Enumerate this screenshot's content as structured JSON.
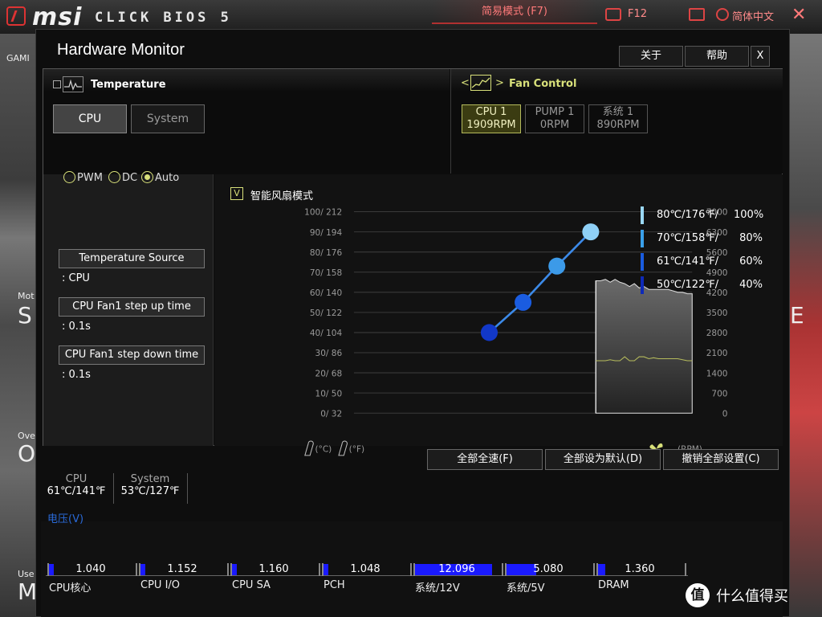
{
  "bios": {
    "brand": "msi",
    "product": "CLICK BIOS 5",
    "ez_mode": "简易模式 (F7)",
    "screenshot_key": "F12",
    "language": "简体中文",
    "left_labels": [
      "GAMI",
      "Mot",
      "S",
      "Ove",
      "O",
      "Use",
      "M"
    ],
    "right_letters": [
      "E"
    ],
    "icons": [
      "msi-logo-icon",
      "screenshot-icon",
      "search-icon",
      "globe-icon",
      "close-icon"
    ]
  },
  "dialog": {
    "title": "Hardware Monitor",
    "buttons": {
      "about": "关于",
      "help": "帮助",
      "close": "X"
    }
  },
  "temperature": {
    "title": "Temperature",
    "tabs": [
      {
        "label": "CPU",
        "active": true
      },
      {
        "label": "System",
        "active": false
      }
    ]
  },
  "fan_control": {
    "title": "Fan Control",
    "prev": "<",
    "next": ">",
    "fans": [
      {
        "name": "CPU 1",
        "rpm": "1909RPM",
        "active": true
      },
      {
        "name": "PUMP 1",
        "rpm": "0RPM",
        "active": false
      },
      {
        "name": "系统 1",
        "rpm": "890RPM",
        "active": false
      }
    ]
  },
  "fan_mode": {
    "options": [
      "PWM",
      "DC",
      "Auto"
    ],
    "selected": "Auto",
    "temperature_source_label": "Temperature Source",
    "temperature_source_value": ": CPU",
    "step_up_label": "CPU Fan1 step up time",
    "step_up_value": ": 0.1s",
    "step_down_label": "CPU Fan1 step down time",
    "step_down_value": ": 0.1s"
  },
  "smart_fan": {
    "checkbox": "V",
    "label": "智能风扇模式",
    "checked": true
  },
  "chart_data": {
    "type": "line",
    "title": "",
    "left_axis_ticks": [
      "100/ 212",
      "90/ 194",
      "80/ 176",
      "70/ 158",
      "60/ 140",
      "50/ 122",
      "40/ 104",
      "30/  86",
      "20/  68",
      "10/  50",
      "0/  32"
    ],
    "left_axis_units": [
      "(°C)",
      "(°F)"
    ],
    "right_axis_ticks": [
      "7000",
      "6300",
      "5600",
      "4900",
      "4200",
      "3500",
      "2800",
      "2100",
      "1400",
      "700",
      "0"
    ],
    "right_axis_unit": "(RPM)",
    "xlim": [
      0,
      100
    ],
    "ylim": [
      0,
      100
    ],
    "curve_points": [
      {
        "temp": 40,
        "speed": 40,
        "color": "#1238c8"
      },
      {
        "temp": 50,
        "speed": 55,
        "color": "#1a5ce0"
      },
      {
        "temp": 60,
        "speed": 73,
        "color": "#3c9ae8"
      },
      {
        "temp": 70,
        "speed": 90,
        "color": "#8fd0f6"
      }
    ],
    "rpm_history_end_x": 100,
    "rpm_history_start_x": 71.5,
    "rpm_trace": [
      4600,
      4600,
      4650,
      4550,
      4650,
      4550,
      4500,
      4400,
      4500,
      4350,
      4400,
      4300,
      4300,
      4300,
      4300,
      4300,
      4250,
      4200,
      4200,
      4150,
      4150
    ],
    "temp_trace": [
      26,
      26,
      26,
      26.5,
      26,
      26,
      28,
      26,
      26,
      28,
      28,
      27,
      27.5,
      27,
      27,
      27,
      27,
      27,
      26.5,
      26,
      26
    ]
  },
  "legend": [
    {
      "text": "80℃/176℉/",
      "pct": "100%",
      "color": "#9ad8f6"
    },
    {
      "text": "70℃/158℉/",
      "pct": "80%",
      "color": "#3aa0ea"
    },
    {
      "text": "61℃/141℉/",
      "pct": "60%",
      "color": "#1a5ce0"
    },
    {
      "text": "50℃/122℉/",
      "pct": "40%",
      "color": "#0e2ab8"
    }
  ],
  "actions": {
    "full_speed": "全部全速(F)",
    "set_default": "全部设为默认(D)",
    "cancel_all": "撤销全部设置(C)"
  },
  "temps": [
    {
      "label": "CPU",
      "value": "61℃/141℉"
    },
    {
      "label": "System",
      "value": "53℃/127℉"
    }
  ],
  "voltage": {
    "title": "电压(V)",
    "items": [
      {
        "label": "CPU核心",
        "value": "1.040",
        "fill": 0.06
      },
      {
        "label": "CPU I/O",
        "value": "1.152",
        "fill": 0.06
      },
      {
        "label": "CPU SA",
        "value": "1.160",
        "fill": 0.06
      },
      {
        "label": "PCH",
        "value": "1.048",
        "fill": 0.06
      },
      {
        "label": "系统/12V",
        "value": "12.096",
        "fill": 0.89
      },
      {
        "label": "系统/5V",
        "value": "5.080",
        "fill": 0.34
      },
      {
        "label": "DRAM",
        "value": "1.360",
        "fill": 0.08
      }
    ]
  },
  "watermark": {
    "badge": "值",
    "text": "什么值得买"
  }
}
